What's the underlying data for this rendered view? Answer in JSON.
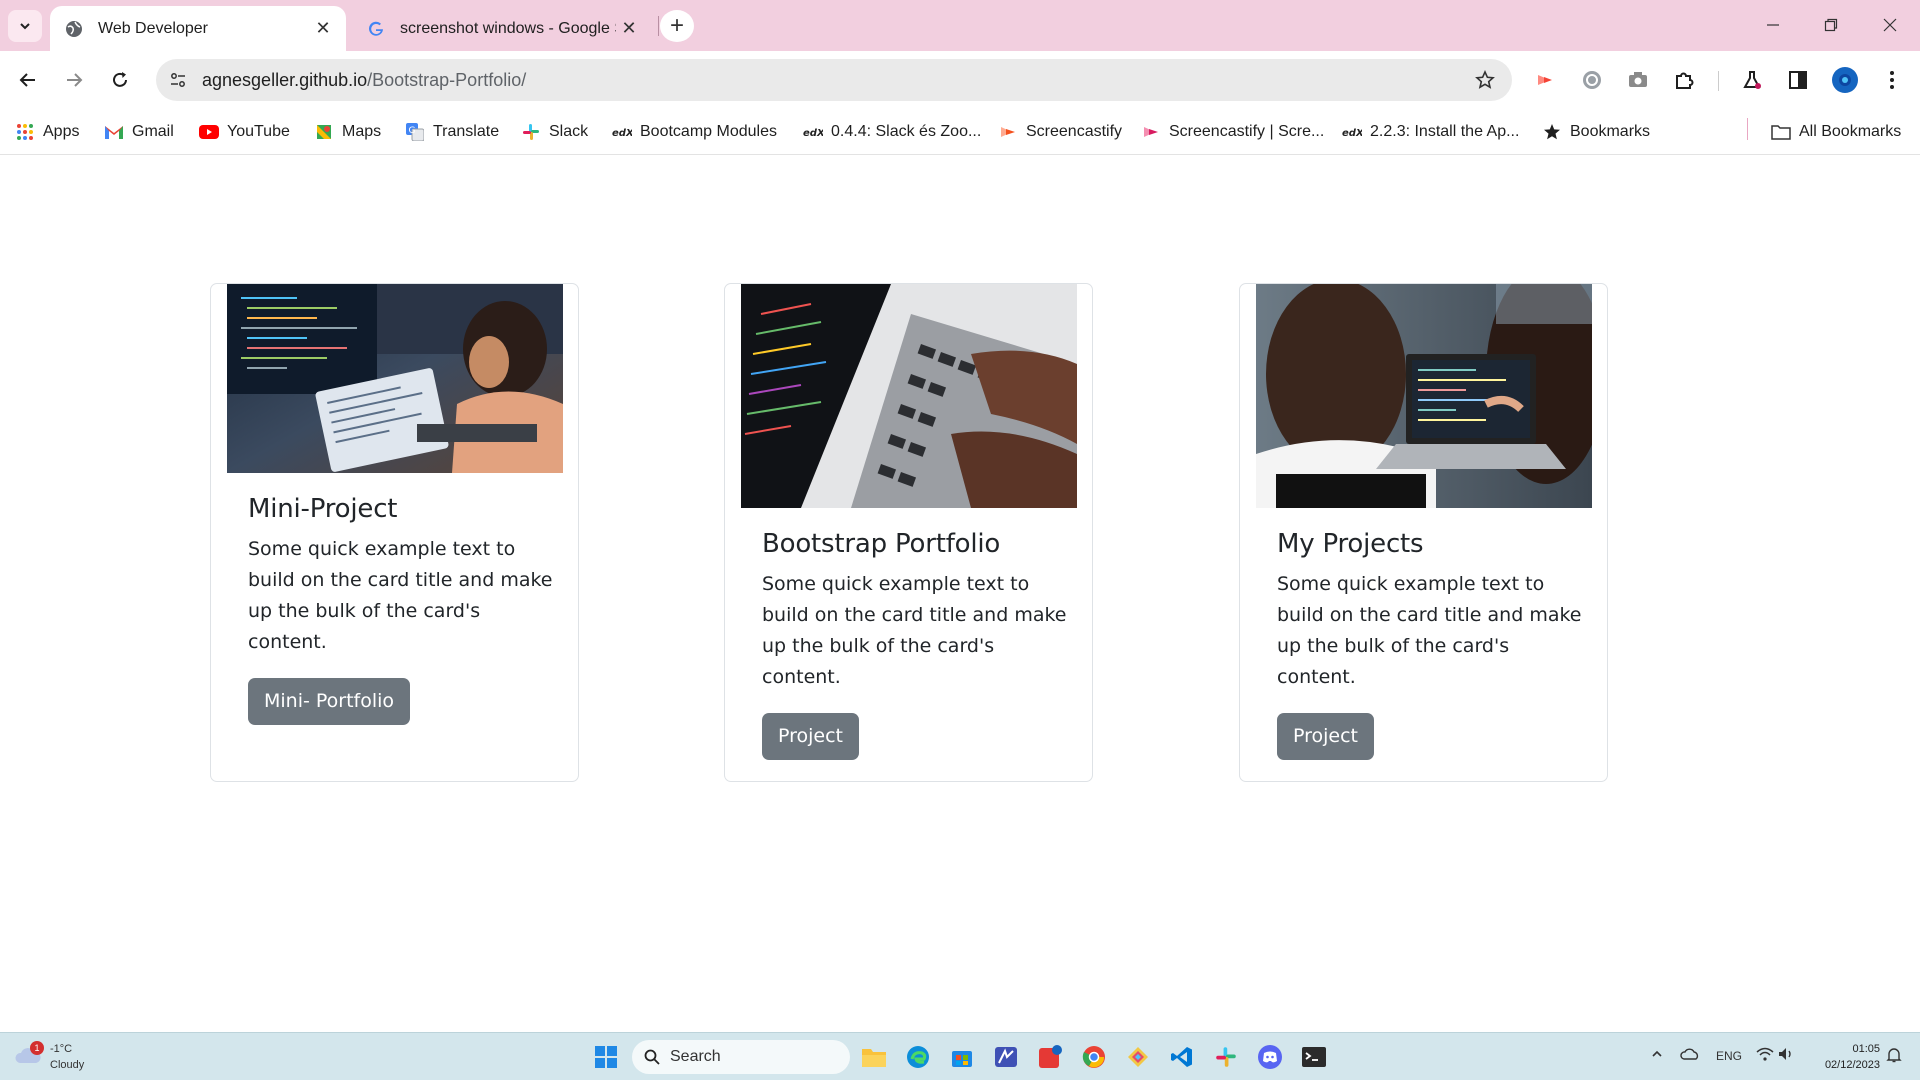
{
  "browser": {
    "tabs": [
      {
        "title": "Web Developer",
        "active": true
      },
      {
        "title": "screenshot windows - Google S",
        "active": false
      }
    ],
    "url": {
      "host": "agnesgeller.github.io",
      "path": "/Bootstrap-Portfolio/"
    },
    "bookmarks": [
      {
        "label": "Apps",
        "icon": "apps-grid-icon"
      },
      {
        "label": "Gmail",
        "icon": "gmail-icon"
      },
      {
        "label": "YouTube",
        "icon": "youtube-icon"
      },
      {
        "label": "Maps",
        "icon": "maps-icon"
      },
      {
        "label": "Translate",
        "icon": "translate-icon"
      },
      {
        "label": "Slack",
        "icon": "slack-icon"
      },
      {
        "label": "Bootcamp Modules",
        "icon": "edx-icon"
      },
      {
        "label": "0.4.4: Slack és Zoo...",
        "icon": "edx-icon"
      },
      {
        "label": "Screencastify",
        "icon": "screencastify-icon"
      },
      {
        "label": "Screencastify | Scre...",
        "icon": "screencastify-icon"
      },
      {
        "label": "2.2.3: Install the Ap...",
        "icon": "edx-icon"
      },
      {
        "label": "Bookmarks",
        "icon": "star-icon"
      }
    ],
    "all_bookmarks_label": "All Bookmarks"
  },
  "cards": [
    {
      "title": "Mini-Project",
      "text": "Some quick example text to build on the card title and make up the bulk of the card's content.",
      "button": "Mini- Portfolio"
    },
    {
      "title": "Bootstrap Portfolio",
      "text": "Some quick example text to build on the card title and make up the bulk of the card's content.",
      "button": "Project"
    },
    {
      "title": "My Projects",
      "text": "Some quick example text to build on the card title and make up the bulk of the card's content.",
      "button": "Project"
    }
  ],
  "taskbar": {
    "weather": {
      "temp": "-1°C",
      "condition": "Cloudy",
      "badge": "1"
    },
    "search_placeholder": "Search",
    "language": "ENG",
    "time": "01:05",
    "date": "02/12/2023"
  },
  "colors": {
    "tabstrip": "#f2cfdf",
    "button": "#6c757d",
    "taskbar": "#d3e6ec"
  }
}
